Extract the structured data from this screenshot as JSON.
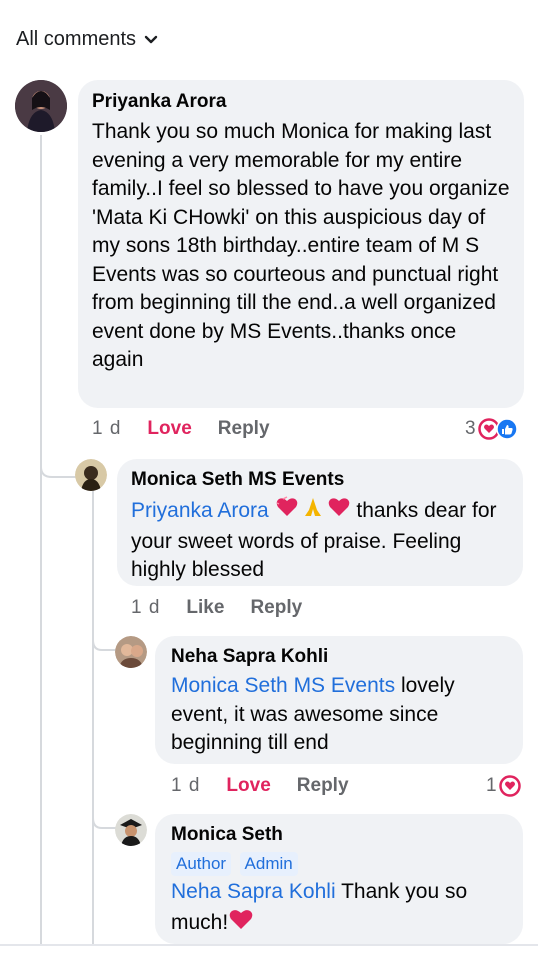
{
  "sort": {
    "label": "All comments"
  },
  "comments": [
    {
      "author": "Priyanka Arora",
      "text": "Thank you so much Monica for making last evening a very memorable for my entire family..I feel so blessed to have you organize 'Mata Ki CHowki' on this auspicious day of my sons 18th birthday..entire team of M S Events was so courteous and punctual right from beginning till the end..a well organized event done by MS Events..thanks once again",
      "time": "1 d",
      "action1": "Love",
      "reply": "Reply",
      "reaction_count": "3"
    },
    {
      "author": "Monica Seth MS Events",
      "mention": "Priyanka Arora",
      "text_after_emoji": "thanks dear",
      "text_rest": "for your sweet words of praise. Feeling highly blessed",
      "time": "1 d",
      "action1": "Like",
      "reply": "Reply"
    },
    {
      "author": "Neha Sapra Kohli",
      "mention": "Monica Seth MS Events",
      "text": "lovely event, it was awesome since beginning till end",
      "time": "1 d",
      "action1": "Love",
      "reply": "Reply",
      "reaction_count": "1"
    },
    {
      "author": "Monica Seth",
      "badges": [
        "Author",
        "Admin"
      ],
      "mention": "Neha Sapra Kohli",
      "text": "Thank you so much!"
    }
  ],
  "colors": {
    "love": "#e0245e",
    "mention": "#216fdb",
    "bubble": "#f0f2f5",
    "like": "#1877f2"
  }
}
